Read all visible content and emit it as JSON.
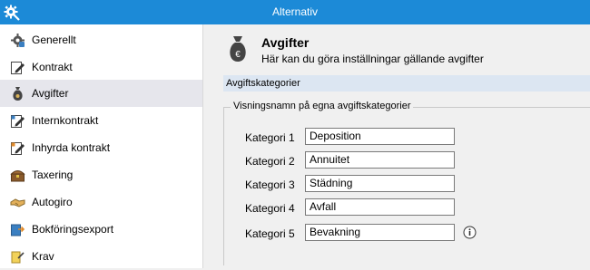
{
  "window": {
    "title": "Alternativ"
  },
  "sidebar": {
    "items": [
      {
        "label": "Generellt",
        "icon": "gear-icon"
      },
      {
        "label": "Kontrakt",
        "icon": "contract-edit-icon"
      },
      {
        "label": "Avgifter",
        "icon": "money-bag-icon",
        "selected": true
      },
      {
        "label": "Internkontrakt",
        "icon": "internal-contract-icon"
      },
      {
        "label": "Inhyrda kontrakt",
        "icon": "rented-contract-icon"
      },
      {
        "label": "Taxering",
        "icon": "treasure-chest-icon"
      },
      {
        "label": "Autogiro",
        "icon": "handshake-icon"
      },
      {
        "label": "Bokföringsexport",
        "icon": "export-icon"
      },
      {
        "label": "Krav",
        "icon": "demand-icon"
      }
    ]
  },
  "header": {
    "title": "Avgifter",
    "subtitle": "Här kan du göra inställningar gällande avgifter",
    "icon": "euro-bag-icon"
  },
  "section": {
    "title": "Avgiftskategorier"
  },
  "group": {
    "legend": "Visningsnamn på egna avgiftskategorier",
    "rows": [
      {
        "label": "Kategori 1",
        "value": "Deposition"
      },
      {
        "label": "Kategori 2",
        "value": "Annuitet"
      },
      {
        "label": "Kategori 3",
        "value": "Städning"
      },
      {
        "label": "Kategori 4",
        "value": "Avfall"
      },
      {
        "label": "Kategori 5",
        "value": "Bevakning"
      }
    ]
  },
  "colors": {
    "titlebar": "#1c8ad7",
    "section_bar": "#dce6f2",
    "selected_item": "#e6e6ec"
  }
}
